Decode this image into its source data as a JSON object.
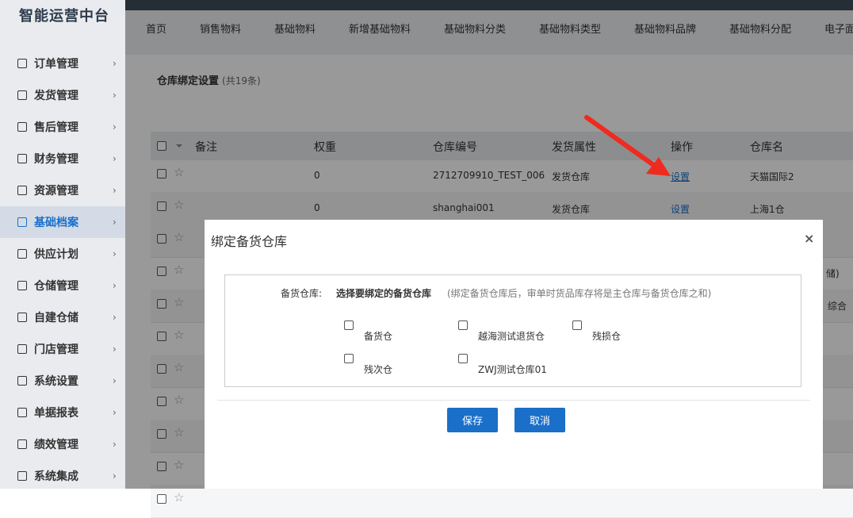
{
  "brand": "智能运营中台",
  "sidebar": {
    "items": [
      {
        "label": "订单管理",
        "icon": "order-icon"
      },
      {
        "label": "发货管理",
        "icon": "truck-icon"
      },
      {
        "label": "售后管理",
        "icon": "aftersale-icon"
      },
      {
        "label": "财务管理",
        "icon": "finance-icon"
      },
      {
        "label": "资源管理",
        "icon": "resource-icon"
      },
      {
        "label": "基础档案",
        "icon": "archive-icon",
        "active": true
      },
      {
        "label": "供应计划",
        "icon": "supply-icon"
      },
      {
        "label": "仓储管理",
        "icon": "warehouse-icon"
      },
      {
        "label": "自建仓储",
        "icon": "self-warehouse-icon"
      },
      {
        "label": "门店管理",
        "icon": "store-icon"
      },
      {
        "label": "系统设置",
        "icon": "settings-icon"
      },
      {
        "label": "单据报表",
        "icon": "report-icon"
      },
      {
        "label": "绩效管理",
        "icon": "performance-icon"
      },
      {
        "label": "系统集成",
        "icon": "integration-icon"
      }
    ],
    "chevron": "›"
  },
  "tabs": [
    "首页",
    "销售物料",
    "基础物料",
    "新增基础物料",
    "基础物料分类",
    "基础物料类型",
    "基础物料品牌",
    "基础物料分配",
    "电子面"
  ],
  "page": {
    "title": "仓库绑定设置",
    "count": "(共19条)"
  },
  "table": {
    "headers": [
      "备注",
      "权重",
      "仓库编号",
      "发货属性",
      "操作",
      "仓库名"
    ],
    "rows": [
      {
        "weight": "0",
        "code": "2712709910_TEST_006",
        "attr": "发货仓库",
        "action": "设置",
        "name": "天猫国际2"
      },
      {
        "weight": "0",
        "code": "shanghai001",
        "attr": "发货仓库",
        "action": "设置",
        "name": "上海1仓"
      }
    ],
    "partial": [
      "储)",
      "综合"
    ]
  },
  "dialog": {
    "title": "绑定备货仓库",
    "close": "×",
    "label": "备货仓库:",
    "strong": "选择要绑定的备货仓库",
    "hint": "(绑定备货仓库后，审单时货品库存将是主仓库与备货仓库之和)",
    "options": [
      "备货仓",
      "越海测试退货仓",
      "残损仓",
      "残次仓",
      "ZWJ测试仓库01"
    ],
    "save": "保存",
    "cancel": "取消"
  },
  "colors": {
    "accent": "#1a6fc9",
    "arrow": "#f02a1e",
    "sidebar_bg": "#e9ebee",
    "topbar": "#3f4e57"
  }
}
